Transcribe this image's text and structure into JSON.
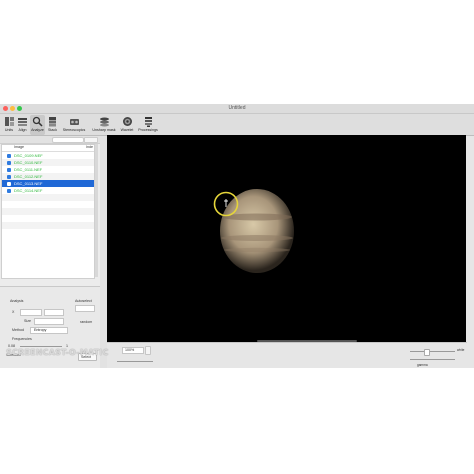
{
  "window": {
    "title": "Untitled"
  },
  "toolbar": [
    {
      "label": "Units",
      "icon": "units-icon"
    },
    {
      "label": "Align",
      "icon": "align-icon"
    },
    {
      "label": "Analyze",
      "icon": "analyze-icon"
    },
    {
      "label": "Stack",
      "icon": "stack-icon"
    },
    {
      "label": "Stereoscopics",
      "icon": "stereoscopics-icon"
    },
    {
      "label": "Unsharp mask",
      "icon": "unsharp-mask-icon"
    },
    {
      "label": "Wavelet",
      "icon": "wavelet-icon"
    },
    {
      "label": "Processings",
      "icon": "processings-icon"
    }
  ],
  "sidebar": {
    "list_header": {
      "col_image": "Image",
      "col_index": "Inde"
    },
    "files": [
      {
        "name": "DSC_0109.NEF",
        "selected": false
      },
      {
        "name": "DSC_0110.NEF",
        "selected": false
      },
      {
        "name": "DSC_0111.NEF",
        "selected": false
      },
      {
        "name": "DSC_0112.NEF",
        "selected": false
      },
      {
        "name": "DSC_0113.NEF",
        "selected": true
      },
      {
        "name": "DSC_0114.NEF",
        "selected": false
      }
    ],
    "analysis": {
      "title": "Analysis",
      "autoselect": "Autoselect",
      "x_label": "X",
      "size_label": "Size",
      "method_label": "Method",
      "method_value": "Entropy",
      "frequencies_label": "Frequencies",
      "freq_min": "0.08",
      "freq_max": "1",
      "mode_label": "Selection",
      "selection_label": "Select",
      "random_label": "random"
    }
  },
  "viewer": {
    "zoom_value": "100%",
    "right_label": "white",
    "right_sub": "gamma"
  },
  "watermark": "SCREENCAST-O-MATIC",
  "colors": {
    "selection": "#1f68d6",
    "file_text": "#2db83a",
    "marker": "#e6d63a"
  }
}
